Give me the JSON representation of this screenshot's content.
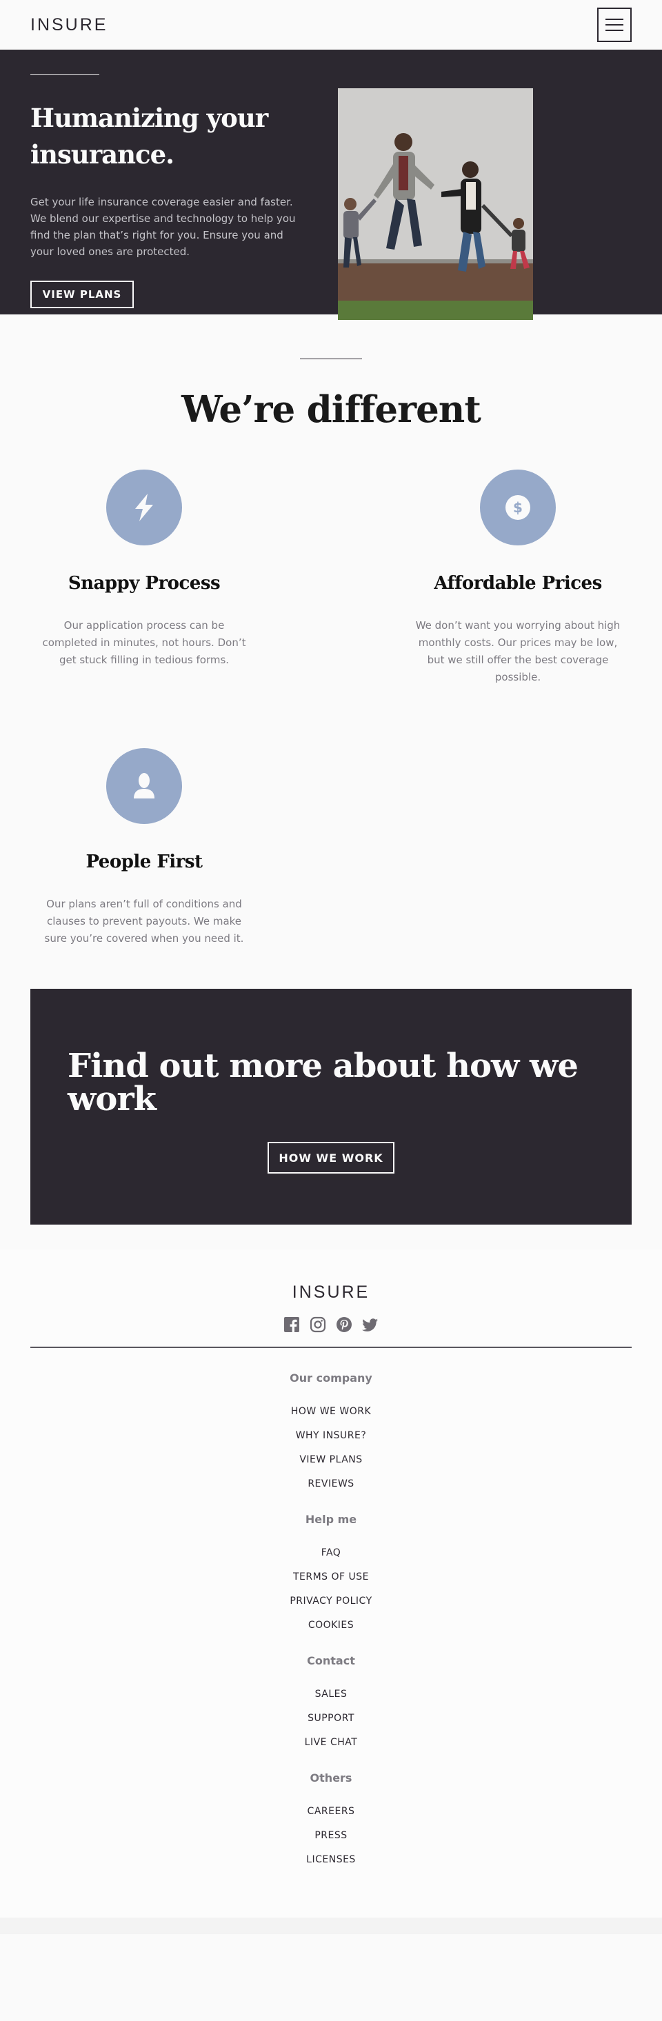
{
  "header": {
    "logo": "INSURE",
    "menu_icon": "hamburger-menu-icon"
  },
  "hero": {
    "title": "Humanizing your insurance.",
    "text": "Get your life insurance coverage easier and faster. We blend our expertise and technology to help you find the plan that’s right for you. Ensure you and your loved ones are protected.",
    "button": "VIEW PLANS",
    "image_alt": "family-photo"
  },
  "different": {
    "title": "We’re different",
    "features": [
      {
        "icon": "lightning-bolt-icon",
        "title": "Snappy Process",
        "text": "Our application process can be completed in minutes, not hours. Don’t get stuck filling in tedious forms."
      },
      {
        "icon": "dollar-icon",
        "title": "Affordable Prices",
        "text": "We don’t want you worrying about high monthly costs. Our prices may be low, but we still offer the best coverage possible."
      },
      {
        "icon": "person-icon",
        "title": "People First",
        "text": "Our plans aren’t full of conditions and clauses to prevent payouts. We make sure you’re covered when you need it."
      }
    ]
  },
  "cta": {
    "title": "Find out more about how we work",
    "button": "HOW WE WORK"
  },
  "footer": {
    "logo": "INSURE",
    "socials": [
      "facebook-icon",
      "instagram-icon",
      "pinterest-icon",
      "twitter-icon"
    ],
    "groups": [
      {
        "heading": "Our company",
        "links": [
          "HOW WE WORK",
          "WHY INSURE?",
          "VIEW PLANS",
          "REVIEWS"
        ]
      },
      {
        "heading": "Help me",
        "links": [
          "FAQ",
          "TERMS OF USE",
          "PRIVACY POLICY",
          "COOKIES"
        ]
      },
      {
        "heading": "Contact",
        "links": [
          "SALES",
          "SUPPORT",
          "LIVE CHAT"
        ]
      },
      {
        "heading": "Others",
        "links": [
          "CAREERS",
          "PRESS",
          "LICENSES"
        ]
      }
    ]
  },
  "colors": {
    "dark": "#2c2830",
    "accent": "#96a9c9",
    "light": "#fafafa",
    "muted": "#7d7b82"
  }
}
